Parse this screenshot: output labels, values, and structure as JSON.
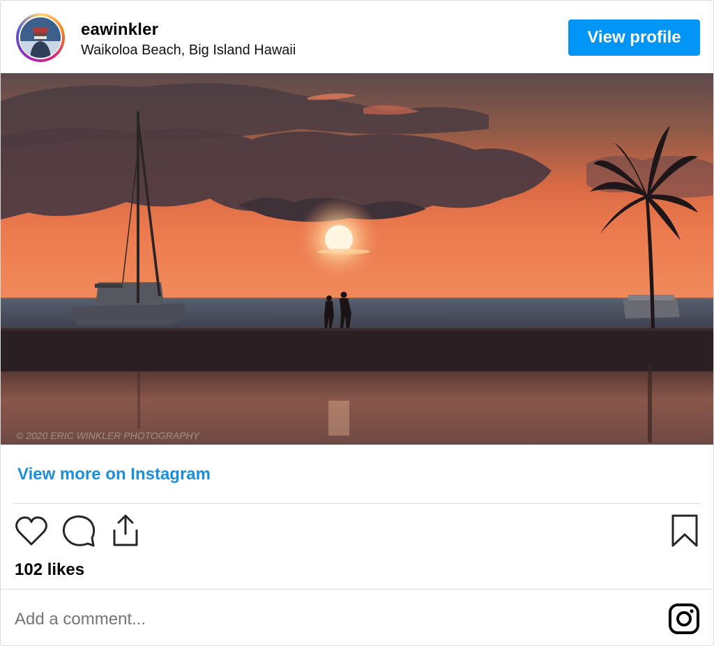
{
  "header": {
    "username": "eawinkler",
    "location": "Waikoloa Beach, Big Island Hawaii",
    "view_profile_label": "View profile",
    "avatar_icon": "profile-avatar"
  },
  "photo": {
    "watermark": "© 2020 ERIC WINKLER PHOTOGRAPHY"
  },
  "links": {
    "view_more": "View more on Instagram"
  },
  "actions": {
    "icons": [
      "heart-icon",
      "comment-icon",
      "share-icon",
      "bookmark-icon"
    ],
    "likes": "102 likes"
  },
  "comment": {
    "placeholder": "Add a comment...",
    "icon": "instagram-icon"
  },
  "colors": {
    "accent": "#0095f6",
    "link": "#1a8fdf",
    "divider": "#dbdbdb",
    "placeholder": "#8e8e8e"
  }
}
